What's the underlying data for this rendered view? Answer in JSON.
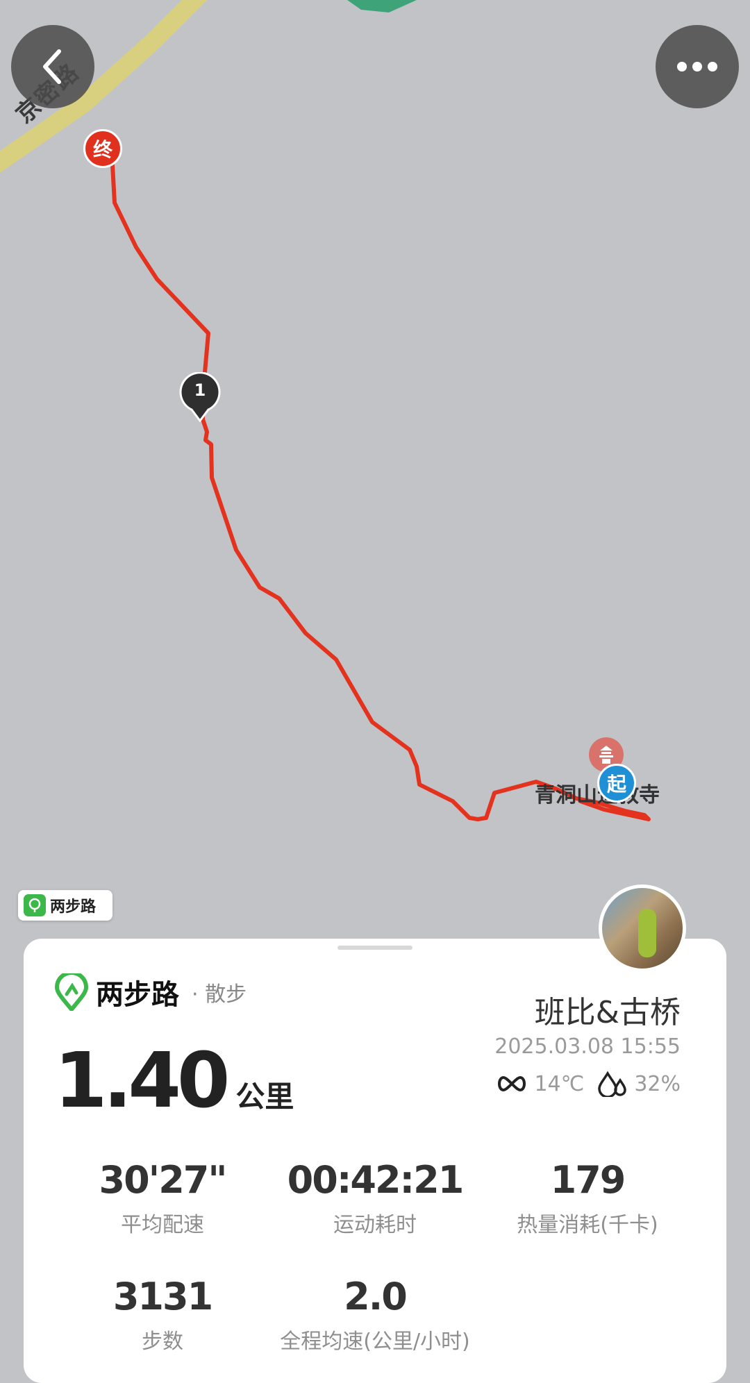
{
  "map": {
    "road_name": "京密路",
    "poi_name": "青洞山道教寺",
    "end_marker_label": "终",
    "start_marker_label": "起",
    "km_marker_label": "1",
    "route_color": "#e3321e",
    "road_color": "#d9d07f"
  },
  "toolbar": {
    "back_icon": "chevron-left-icon",
    "more_icon": "more-horizontal-icon"
  },
  "brand": {
    "map_chip_label": "两步路",
    "card_name": "两步路",
    "activity_type": "· 散步",
    "brand_color": "#3cb84a"
  },
  "user": {
    "name": "班比&古桥",
    "datetime": "2025.03.08 15:55"
  },
  "weather": {
    "temperature": "14℃",
    "humidity": "32%"
  },
  "summary": {
    "distance_value": "1.40",
    "distance_unit": "公里"
  },
  "stats": [
    {
      "value": "30'27\"",
      "label": "平均配速"
    },
    {
      "value": "00:42:21",
      "label": "运动耗时"
    },
    {
      "value": "179",
      "label": "热量消耗(千卡)"
    },
    {
      "value": "3131",
      "label": "步数"
    },
    {
      "value": "2.0",
      "label": "全程均速(公里/小时)"
    }
  ]
}
